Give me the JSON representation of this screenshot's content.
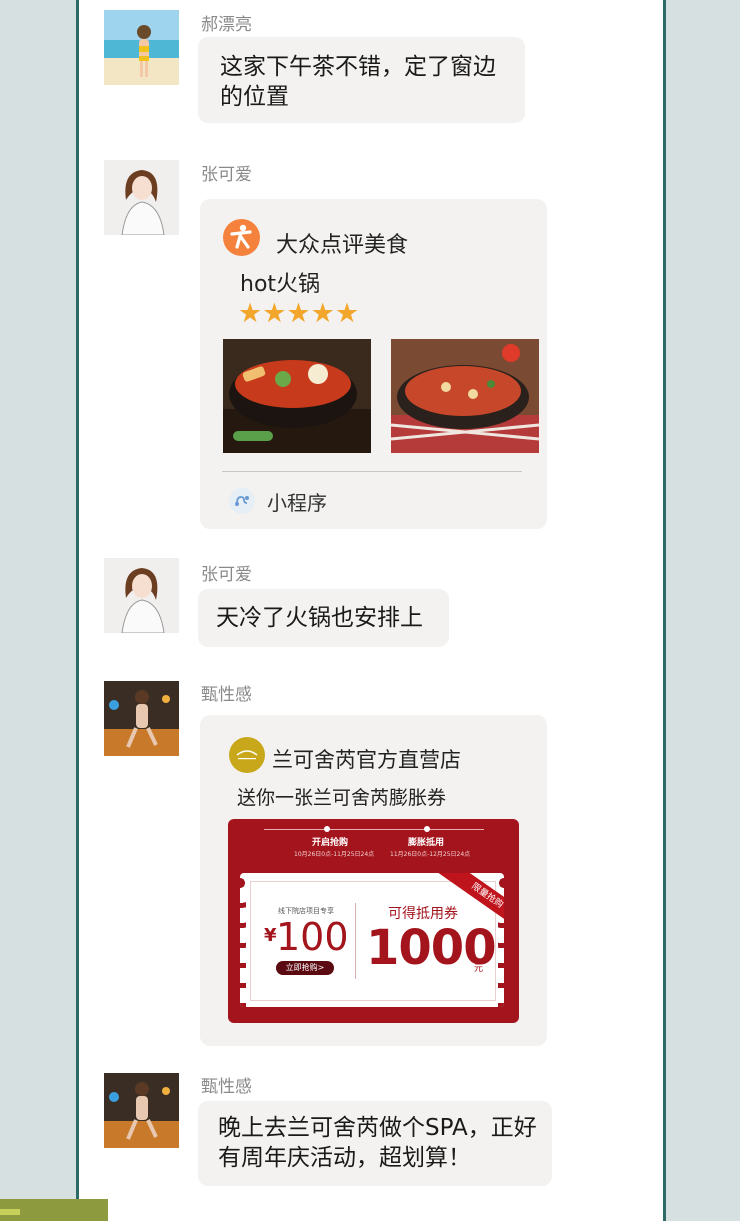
{
  "messages": [
    {
      "sender": "郝漂亮",
      "text": "这家下午茶不错，定了窗边的位置"
    },
    {
      "sender": "张可爱",
      "card": {
        "app_name": "大众点评美食",
        "shop": "hot火锅",
        "rating": 5,
        "stars": "★★★★★",
        "footer": "小程序",
        "images": [
          "hotpot-photo-1",
          "hotpot-photo-2"
        ]
      }
    },
    {
      "sender": "张可爱",
      "text": "天冷了火锅也安排上"
    },
    {
      "sender": "甄性感",
      "card": {
        "shop": "兰可舍芮官方直营店",
        "subtitle": "送你一张兰可舍芮膨胀券",
        "coupon": {
          "step1_title": "开启抢购",
          "step1_date": "10月26日0点-11月25日24点",
          "step2_title": "膨胀抵用",
          "step2_date": "11月26日0点-12月25日24点",
          "tag": "线下院店项目专享",
          "currency": "¥",
          "price": "100",
          "buy_button": "立即抢购>",
          "worth_label": "可得抵用券",
          "worth_value": "1000",
          "worth_unit": "元",
          "ribbon": "限量抢购"
        }
      }
    },
    {
      "sender": "甄性感",
      "text": "晚上去兰可舍芮做个SPA，正好有周年庆活动，超划算！"
    }
  ],
  "colors": {
    "background": "#d6e0e0",
    "panel_border": "#2e6b66",
    "bubble": "#f3f2f0",
    "dianping_orange": "#f5823c",
    "coupon_red": "#a3141c",
    "star": "#f2a62c"
  }
}
